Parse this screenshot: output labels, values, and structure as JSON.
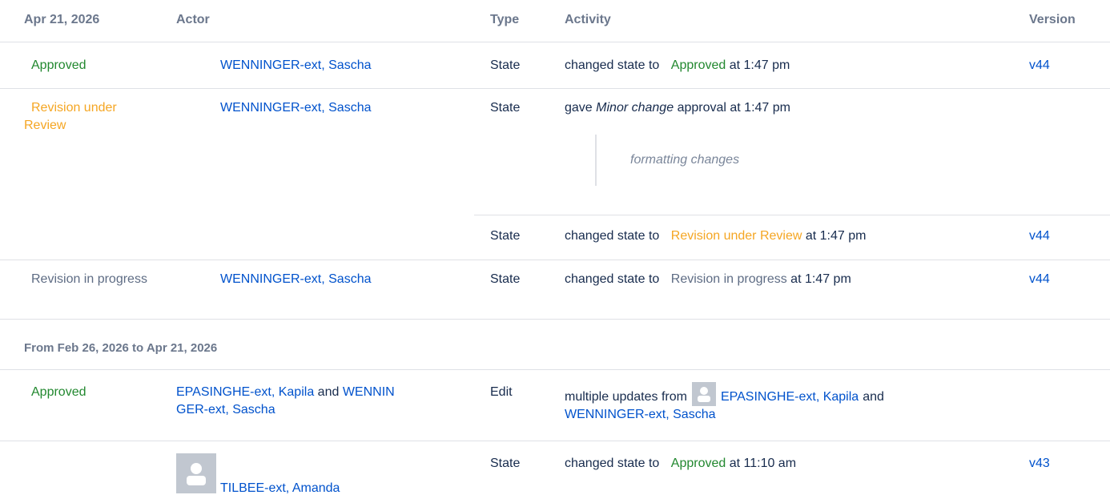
{
  "header": {
    "date": "Apr 21, 2026",
    "actor": "Actor",
    "type": "Type",
    "activity": "Activity",
    "version": "Version"
  },
  "rows": [
    {
      "state": "Approved",
      "actor": "WENNINGER-ext, Sascha",
      "type": "State",
      "activity_prefix": "changed state to",
      "activity_state": "Approved",
      "activity_suffix": "at 1:47 pm",
      "version": "v44"
    },
    {
      "state": "Revision under Review",
      "actor": "WENNINGER-ext, Sascha",
      "type": "State",
      "approval_prefix": "gave",
      "approval_type": "Minor change",
      "approval_suffix": "approval at 1:47 pm",
      "comment": "formatting changes",
      "type2": "State",
      "activity_prefix": "changed state to",
      "activity_state": "Revision under Review",
      "activity_suffix": "at 1:47 pm",
      "version": "v44"
    },
    {
      "state": "Revision in progress",
      "actor": "WENNINGER-ext, Sascha",
      "type": "State",
      "activity_prefix": "changed state to",
      "activity_state": "Revision in progress",
      "activity_suffix": "at 1:47 pm",
      "version": "v44"
    }
  ],
  "section2": {
    "title": "From Feb 26, 2026 to Apr 21, 2026",
    "rows": [
      {
        "state": "Approved",
        "actor_a": "EPASINGHE-ext, Kapila",
        "and": "and",
        "actor_b": "WENNINGER-ext, Sascha",
        "type": "Edit",
        "activity_prefix": "multiple updates from",
        "activity_actor_a": "EPASINGHE-ext, Kapila",
        "activity_and": "and",
        "activity_actor_b": "WENNINGER-ext, Sascha"
      },
      {
        "actor": "TILBEE-ext, Amanda",
        "type": "State",
        "activity_prefix": "changed state to",
        "activity_state": "Approved",
        "activity_suffix": "at 11:10 am",
        "version": "v43"
      }
    ]
  },
  "colors": {
    "approved": "#22882f",
    "review": "#f5a623",
    "progress": "#5e6c84",
    "link": "#0052cc"
  }
}
